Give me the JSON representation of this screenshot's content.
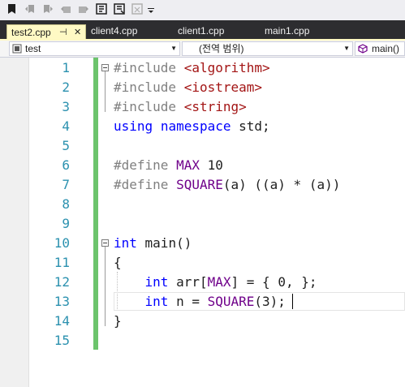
{
  "tabs": [
    {
      "label": "test2.cpp",
      "active": true,
      "pin_glyph": "⊣",
      "close_glyph": "✕"
    },
    {
      "label": "client4.cpp",
      "active": false
    },
    {
      "label": "client1.cpp",
      "active": false
    },
    {
      "label": "main1.cpp",
      "active": false
    }
  ],
  "nav": {
    "project": "test",
    "scope": "(전역 범위)",
    "member": "main()"
  },
  "editor": {
    "line_numbers": [
      "1",
      "2",
      "3",
      "4",
      "5",
      "6",
      "7",
      "8",
      "9",
      "10",
      "11",
      "12",
      "13",
      "14",
      "15"
    ],
    "code": [
      [
        {
          "t": "#include ",
          "c": "pp"
        },
        {
          "t": "<algorithm>",
          "c": "str"
        }
      ],
      [
        {
          "t": "#include ",
          "c": "pp"
        },
        {
          "t": "<iostream>",
          "c": "str"
        }
      ],
      [
        {
          "t": "#include ",
          "c": "pp"
        },
        {
          "t": "<string>",
          "c": "str"
        }
      ],
      [
        {
          "t": "using",
          "c": "kw"
        },
        {
          "t": " "
        },
        {
          "t": "namespace",
          "c": "kw"
        },
        {
          "t": " std;"
        }
      ],
      [],
      [
        {
          "t": "#define ",
          "c": "pp"
        },
        {
          "t": "MAX",
          "c": "macro"
        },
        {
          "t": " 10"
        }
      ],
      [
        {
          "t": "#define ",
          "c": "pp"
        },
        {
          "t": "SQUARE",
          "c": "macro"
        },
        {
          "t": "(a) ((a) * (a))"
        }
      ],
      [],
      [],
      [
        {
          "t": "int",
          "c": "kw"
        },
        {
          "t": " main()"
        }
      ],
      [
        {
          "t": "{"
        }
      ],
      [
        {
          "t": "    "
        },
        {
          "t": "int",
          "c": "kw"
        },
        {
          "t": " arr["
        },
        {
          "t": "MAX",
          "c": "macro"
        },
        {
          "t": "] = { 0, };"
        }
      ],
      [
        {
          "t": "    "
        },
        {
          "t": "int",
          "c": "kw"
        },
        {
          "t": " n = "
        },
        {
          "t": "SQUARE",
          "c": "macro"
        },
        {
          "t": "(3);"
        }
      ],
      [
        {
          "t": "}"
        }
      ],
      []
    ]
  },
  "colors": {
    "pp": "#808080",
    "str": "#a31515",
    "kw": "#0000ff",
    "macro": "#6f008a",
    "line_number": "#2b91af",
    "change_bar": "#6cc46c",
    "active_tab": "#fff9c4",
    "tabstrip": "#2d2d30"
  },
  "icons": [
    "bookmark-icon",
    "prev-bookmark-icon",
    "next-bookmark-icon",
    "prev-bookmark-folder-icon",
    "next-bookmark-folder-icon",
    "comment-icon",
    "uncomment-icon",
    "toolbar-options-icon"
  ]
}
